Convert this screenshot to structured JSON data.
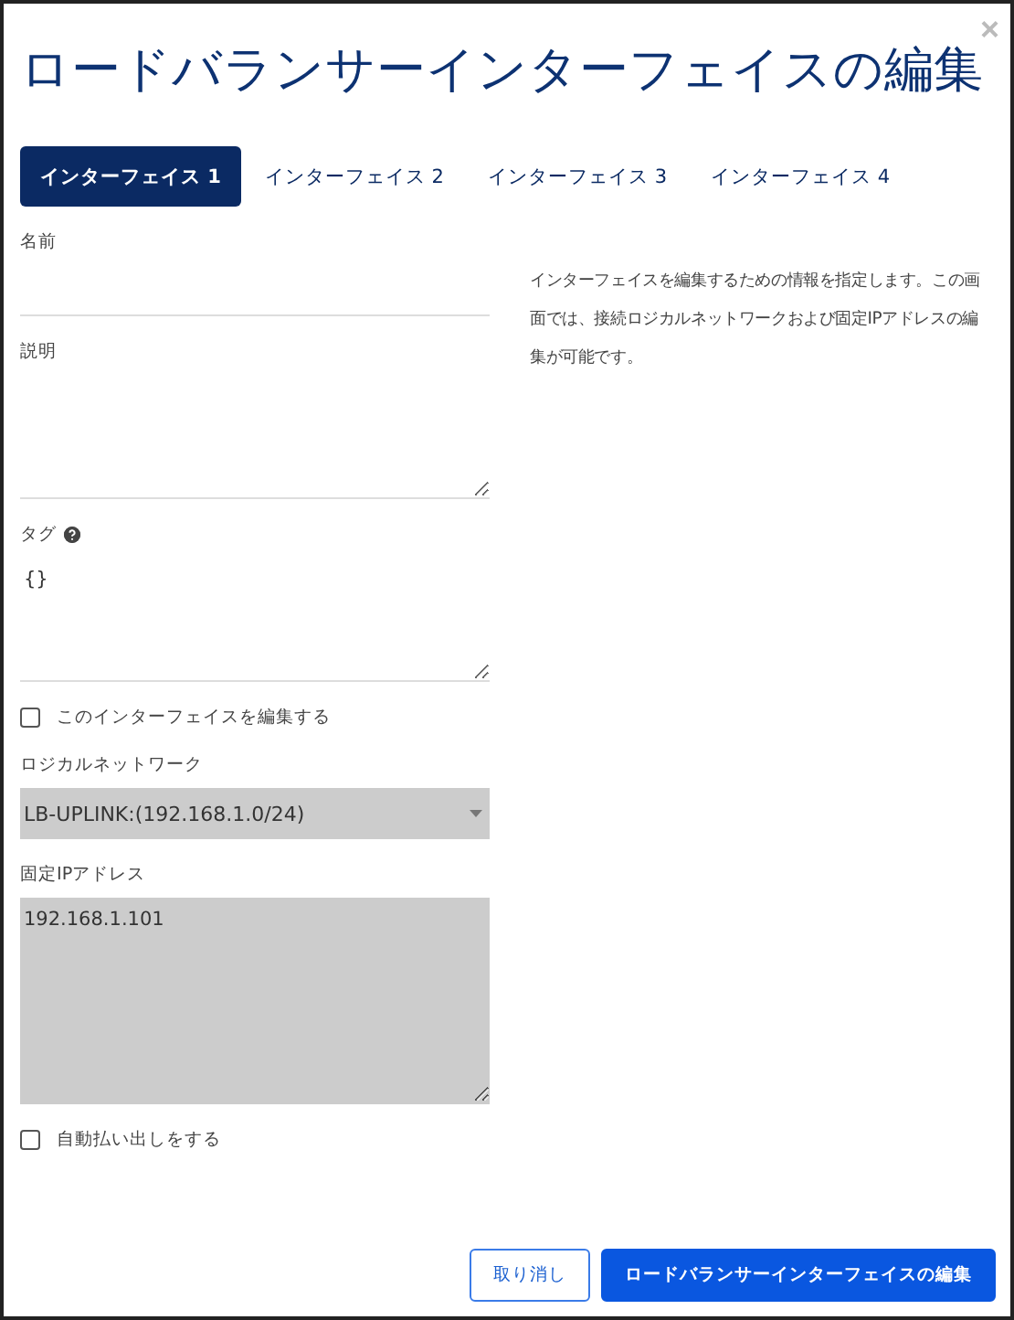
{
  "dialog": {
    "title": "ロードバランサーインターフェイスの編集",
    "close": "×"
  },
  "tabs": [
    {
      "label": "インターフェイス 1",
      "selected": true
    },
    {
      "label": "インターフェイス 2",
      "selected": false
    },
    {
      "label": "インターフェイス 3",
      "selected": false
    },
    {
      "label": "インターフェイス 4",
      "selected": false
    }
  ],
  "description": "インターフェイスを編集するための情報を指定します。この画面では、接続ロジカルネットワークおよび固定IPアドレスの編集が可能です。",
  "fields": [
    {
      "kind": "text",
      "label": "名前"
    },
    {
      "kind": "textarea",
      "label": "説明",
      "disabled": false
    },
    {
      "kind": "textarea",
      "label": "タグ",
      "help": true,
      "value": "{}",
      "disabled": false
    },
    {
      "kind": "checkbox",
      "label": "このインターフェイスを編集する",
      "checked": false
    },
    {
      "kind": "select",
      "label": "ロジカルネットワーク",
      "value": "LB-UPLINK:(192.168.1.0/24)",
      "disabled": true
    },
    {
      "kind": "bigarea",
      "label": "固定IPアドレス",
      "value": "192.168.1.101",
      "disabled": true
    },
    {
      "kind": "checkbox",
      "label": "自動払い出しをする",
      "checked": false
    }
  ],
  "buttons": [
    {
      "label": "取り消し",
      "kind": "secondary"
    },
    {
      "label": "ロードバランサーインターフェイスの編集",
      "kind": "primary"
    }
  ]
}
